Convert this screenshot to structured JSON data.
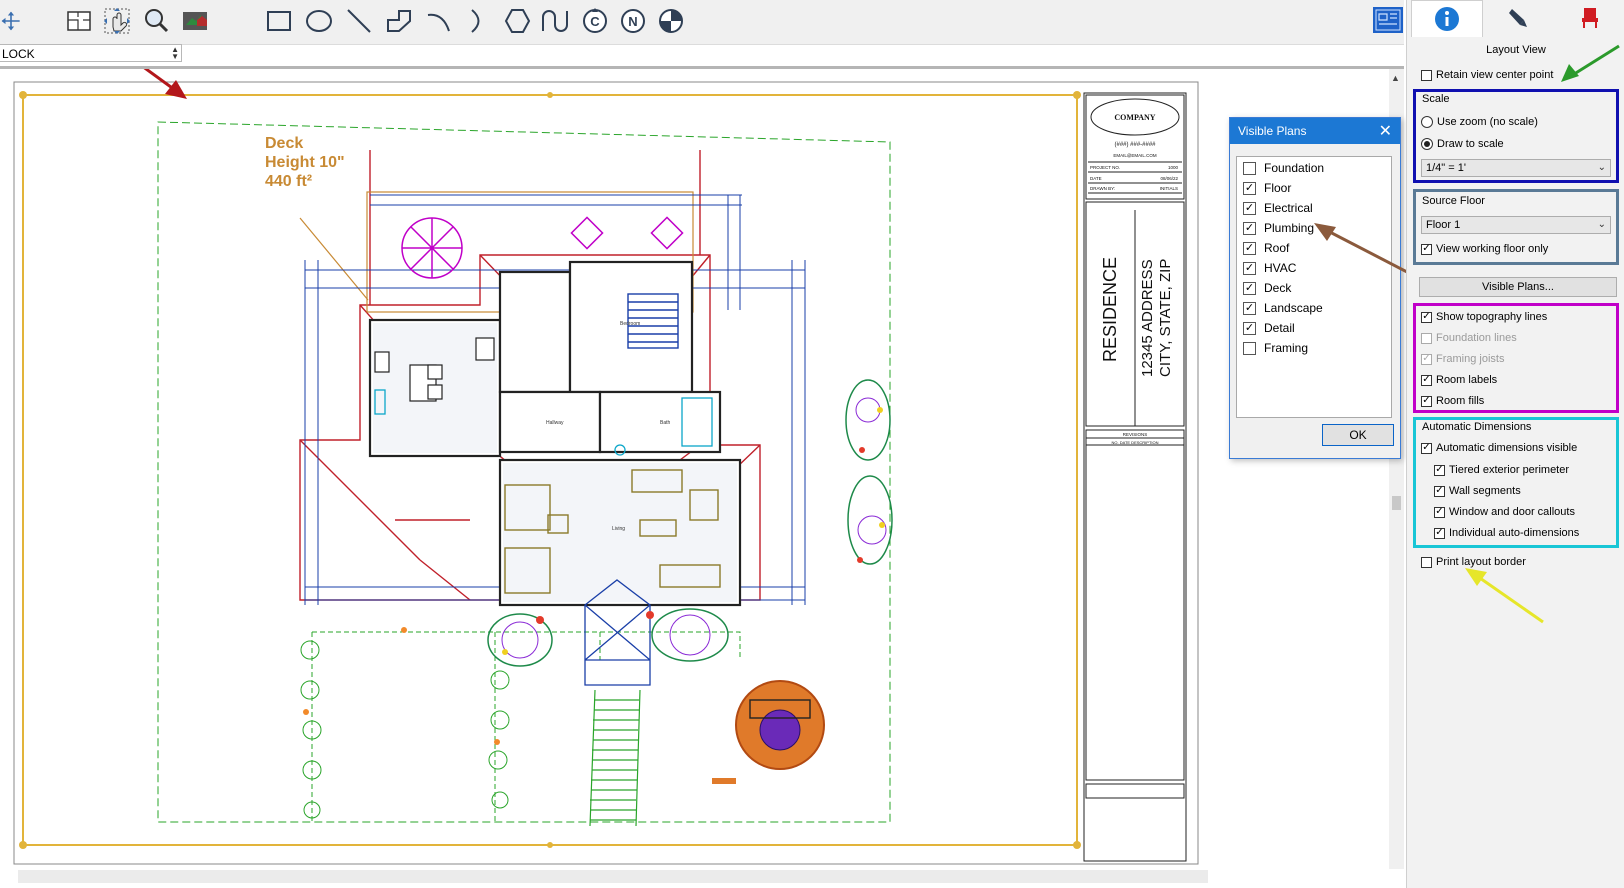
{
  "toolbar": {
    "icons": [
      "pan-icon",
      "floor-plan-view-icon",
      "hand-pan-icon",
      "zoom-icon",
      "3d-view-icon",
      "rectangle-icon",
      "circle-icon",
      "line-icon",
      "polyline-icon",
      "arc-icon",
      "curve-icon",
      "polygon-icon",
      "spline-icon",
      "copyright-symbol-icon",
      "north-arrow-icon",
      "target-icon"
    ],
    "layer_value": "LOCK",
    "layout_icon": "layout-view-icon"
  },
  "drawing": {
    "deck_label_line1": "Deck",
    "deck_label_line2": "Height 10\"",
    "deck_label_line3": "440 ft²",
    "title_block": {
      "company": "COMPANY",
      "phone": "(###) ###-####",
      "email": "EMAIL@EMAIL.COM",
      "rows": [
        {
          "label": "PROJECT NO.",
          "value": "1000"
        },
        {
          "label": "DATE",
          "value": "08/06/22"
        },
        {
          "label": "DRAWN BY:",
          "value": "INITIALS"
        }
      ],
      "residence": "RESIDENCE",
      "address_line1": "12345 ADDRESS",
      "address_line2": "CITY, STATE, ZIP",
      "revisions": "REVISIONS",
      "rev_cols": "NO.   DATE      DESCRIPTION"
    },
    "room_labels": [
      "Bedroom",
      "Hallway",
      "Bath",
      "Living"
    ],
    "colors": {
      "deck": "#c88a34",
      "walls": "#222222",
      "roof": "#c0202a",
      "dimensions": "#1a3fa8",
      "plumbing": "#0aa6c9",
      "landscape": "#2aa52a",
      "furniture": "#c8c8c8",
      "border": "#e2b43a"
    }
  },
  "dialog": {
    "title": "Visible Plans",
    "close": "✕",
    "items": [
      {
        "label": "Foundation",
        "checked": false
      },
      {
        "label": "Floor",
        "checked": true
      },
      {
        "label": "Electrical",
        "checked": true
      },
      {
        "label": "Plumbing",
        "checked": true
      },
      {
        "label": "Roof",
        "checked": true
      },
      {
        "label": "HVAC",
        "checked": true
      },
      {
        "label": "Deck",
        "checked": true
      },
      {
        "label": "Landscape",
        "checked": true
      },
      {
        "label": "Detail",
        "checked": true
      },
      {
        "label": "Framing",
        "checked": false
      }
    ],
    "ok": "OK"
  },
  "panel": {
    "tabs": [
      "info-icon",
      "pen-icon",
      "chair-icon"
    ],
    "title": "Layout View",
    "retain_center": {
      "label": "Retain view center point",
      "checked": false
    },
    "scale": {
      "label": "Scale",
      "options": [
        {
          "label": "Use zoom (no scale)",
          "selected": false
        },
        {
          "label": "Draw to scale",
          "selected": true
        }
      ],
      "value": "1/4\" = 1'"
    },
    "source_floor": {
      "label": "Source Floor",
      "value": "Floor 1",
      "working_only": {
        "label": "View working floor only",
        "checked": true
      }
    },
    "visible_plans_button": "Visible Plans...",
    "display": [
      {
        "label": "Show topography lines",
        "checked": true,
        "enabled": true
      },
      {
        "label": "Foundation lines",
        "checked": false,
        "enabled": false
      },
      {
        "label": "Framing joists",
        "checked": true,
        "enabled": false
      },
      {
        "label": "Room labels",
        "checked": true,
        "enabled": true
      },
      {
        "label": "Room fills",
        "checked": true,
        "enabled": true
      }
    ],
    "auto_dims": {
      "label": "Automatic Dimensions",
      "visible": {
        "label": "Automatic dimensions visible",
        "checked": true
      },
      "items": [
        {
          "label": "Tiered exterior perimeter",
          "checked": true
        },
        {
          "label": "Wall segments",
          "checked": true
        },
        {
          "label": "Window and door callouts",
          "checked": true
        },
        {
          "label": "Individual auto-dimensions",
          "checked": true
        }
      ]
    },
    "print_border": {
      "label": "Print layout border",
      "checked": false
    },
    "group_colors": {
      "scale": "#1010b0",
      "source": "#5a7a96",
      "display": "#c000c8",
      "auto_dims": "#19c6d6"
    }
  },
  "annotation_arrows": {
    "colors": [
      "#b3171b",
      "#2b9a2b",
      "#8b5a3c",
      "#e6e62a"
    ]
  }
}
